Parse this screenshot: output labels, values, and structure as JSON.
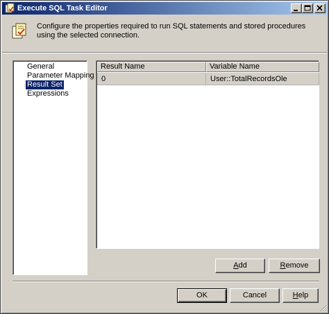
{
  "window": {
    "title": "Execute SQL Task Editor",
    "buttons": {
      "minimize": "_",
      "maximize": "□",
      "close": "×"
    }
  },
  "header": {
    "icon": "sql-task-icon",
    "description": "Configure the properties required to run SQL statements and stored procedures using the selected connection."
  },
  "nav": {
    "items": [
      {
        "label": "General",
        "selected": false
      },
      {
        "label": "Parameter Mapping",
        "selected": false
      },
      {
        "label": "Result Set",
        "selected": true
      },
      {
        "label": "Expressions",
        "selected": false
      }
    ]
  },
  "grid": {
    "columns": [
      "Result Name",
      "Variable Name"
    ],
    "rows": [
      [
        "0",
        "User::TotalRecordsOle"
      ]
    ]
  },
  "actions": {
    "add_prefix": "",
    "add_accel": "A",
    "add_rest": "dd",
    "remove_prefix": "",
    "remove_accel": "R",
    "remove_rest": "emove"
  },
  "footer": {
    "ok": "OK",
    "cancel": "Cancel",
    "help_accel": "H",
    "help_rest": "elp"
  },
  "colors": {
    "title_start": "#0a246a",
    "title_end": "#a6caf0",
    "face": "#d4d0c8",
    "selection": "#0a246a"
  }
}
